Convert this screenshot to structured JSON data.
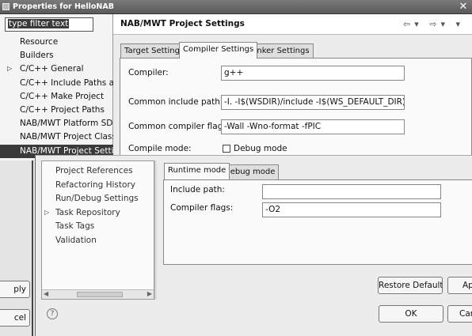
{
  "window": {
    "title": "Properties for HelloNAB",
    "close_glyph": "✕"
  },
  "back": {
    "filter": {
      "placeholder": "type filter text",
      "value": "type filter text"
    },
    "tree": [
      {
        "label": "Resource",
        "expandable": false
      },
      {
        "label": "Builders",
        "expandable": false
      },
      {
        "label": "C/C++ General",
        "expandable": true
      },
      {
        "label": "C/C++ Include Paths and",
        "expandable": false
      },
      {
        "label": "C/C++ Make Project",
        "expandable": false
      },
      {
        "label": "C/C++ Project Paths",
        "expandable": false
      },
      {
        "label": "NAB/MWT Platform SDK",
        "expandable": false
      },
      {
        "label": "NAB/MWT Project Class",
        "expandable": false
      },
      {
        "label": "NAB/MWT Project Setting",
        "expandable": false,
        "selected": true
      }
    ],
    "page_title": "NAB/MWT Project Settings",
    "nav_icons": "⇦▾ ⇨▾ ▾",
    "tabs": [
      "Target Settings",
      "Compiler Settings",
      "Linker Settings"
    ],
    "active_tab": 1,
    "form": {
      "compiler_label": "Compiler:",
      "compiler_value": "g++",
      "include_label": "Common include path:",
      "include_value": "-I. -I$(WSDIR)/include -I$(WS_DEFAULT_DIR)/incl",
      "flags_label": "Common compiler flags:",
      "flags_value": "-Wall -Wno-format -fPIC",
      "mode_label": "Compile mode:",
      "debug_mode_label": "Debug mode",
      "debug_mode_checked": false
    },
    "apply_partial": "ply",
    "cancel_partial": "cel"
  },
  "front": {
    "tree": [
      {
        "label": "Project References",
        "expandable": false
      },
      {
        "label": "Refactoring History",
        "expandable": false
      },
      {
        "label": "Run/Debug Settings",
        "expandable": false
      },
      {
        "label": "Task Repository",
        "expandable": true
      },
      {
        "label": "Task Tags",
        "expandable": false
      },
      {
        "label": "Validation",
        "expandable": false
      }
    ],
    "tabs": [
      "Runtime mode",
      "Debug mode"
    ],
    "active_tab": 0,
    "form": {
      "include_label": "Include path:",
      "include_value": "",
      "flags_label": "Compiler flags:",
      "flags_value": "-O2"
    },
    "restore_defaults": "Restore Defaults",
    "apply_partial": "Ap",
    "ok": "OK",
    "cancel_partial": "Can",
    "help_glyph": "?"
  }
}
